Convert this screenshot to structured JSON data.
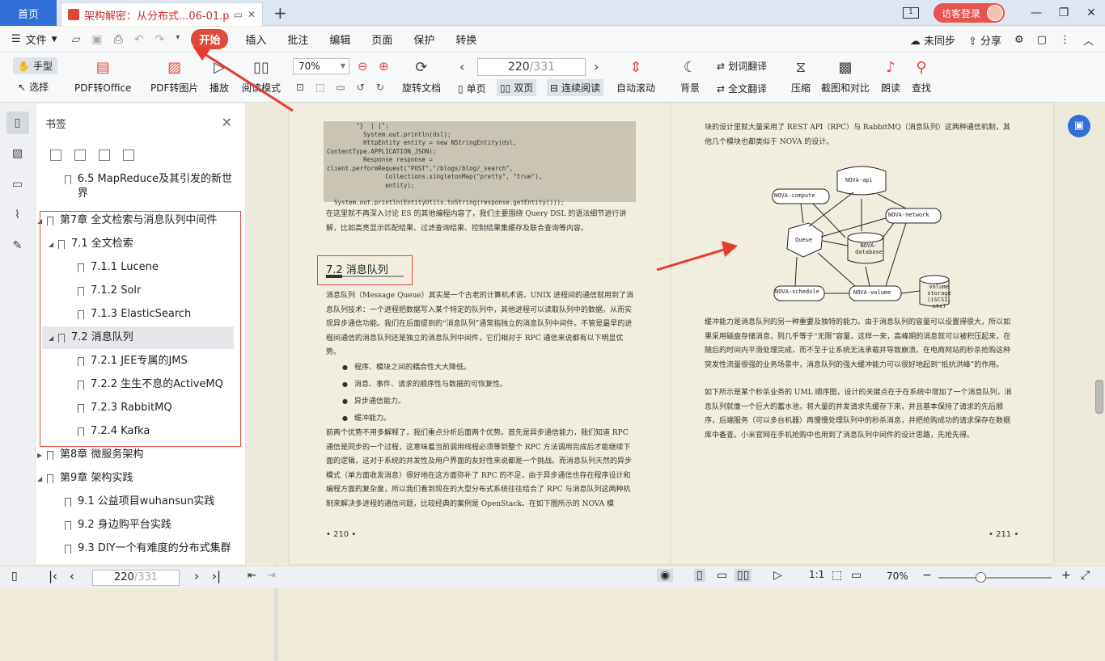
{
  "tabs": {
    "home": "首页",
    "doc": "架构解密：从分布式...06-01.pdf"
  },
  "header": {
    "login": "访客登录"
  },
  "menu": {
    "file": "文件",
    "items": [
      "开始",
      "插入",
      "批注",
      "编辑",
      "页面",
      "保护",
      "转换"
    ],
    "sync": "未同步",
    "share": "分享"
  },
  "ribbon": {
    "hand": "手型",
    "select": "选择",
    "pdf_office": "PDF转Office",
    "pdf_image": "PDF转图片",
    "play": "播放",
    "read_mode": "阅读模式",
    "zoom": "70%",
    "rotate": "旋转文档",
    "page_current": "220",
    "page_total": "/331",
    "single": "单页",
    "double": "双页",
    "continuous": "连续阅读",
    "auto_scroll": "自动滚动",
    "background": "背景",
    "word_translate": "划词翻译",
    "full_translate": "全文翻译",
    "compress": "压缩",
    "screenshot_compare": "截图和对比",
    "read_aloud": "朗读",
    "find": "查找"
  },
  "bookmarks": {
    "title": "书签",
    "items": [
      {
        "label": "6.5 MapReduce及其引发的新世界",
        "level": 1
      },
      {
        "label": "第7章 全文检索与消息队列中间件",
        "level": 0
      },
      {
        "label": "7.1 全文检索",
        "level": 1
      },
      {
        "label": "7.1.1 Lucene",
        "level": 2
      },
      {
        "label": "7.1.2 Solr",
        "level": 2
      },
      {
        "label": "7.1.3 ElasticSearch",
        "level": 2
      },
      {
        "label": "7.2 消息队列",
        "level": 1
      },
      {
        "label": "7.2.1 JEE专属的JMS",
        "level": 2
      },
      {
        "label": "7.2.2 生生不息的ActiveMQ",
        "level": 2
      },
      {
        "label": "7.2.3 RabbitMQ",
        "level": 2
      },
      {
        "label": "7.2.4 Kafka",
        "level": 2
      },
      {
        "label": "第8章 微服务架构",
        "level": 0
      },
      {
        "label": "第9章 架构实践",
        "level": 0
      },
      {
        "label": "9.1 公益项目wuhansun实践",
        "level": 1
      },
      {
        "label": "9.2 身边购平台实践",
        "level": 1
      },
      {
        "label": "9.3 DIY一个有难度的分布式集群",
        "level": 1
      }
    ]
  },
  "left_page": {
    "code": "        \"}  | |\";\n          System.out.println(dsl);\n          HttpEntity entity = new NStringEntity(dsl,\nContentType.APPLICATION_JSON);\n          Response response =\nclient.performRequest(\"POST\",\"/blogs/blog/_search\",\n                Collections.singletonMap(\"pretty\", \"true\"),\n                entity);\n\n  System.out.println(EntityUtils.toString(response.getEntity()));",
    "para1": "在这里就不再深入讨论 ES 的其他编程内容了，我们主要围绕 Query DSL 的语法细节进行讲解，比如高亮显示匹配结果、过滤查询结果、控制结果集缓存及联合查询等内容。",
    "section": "7.2   消息队列",
    "para2": "消息队列（Message Queue）其实是一个古老的计算机术语，UNIX 进程间的通信就用到了消息队列技术：一个进程把数据写入某个特定的队列中，其他进程可以读取队列中的数据，从而实现异步通信功能。我们在后面提到的“消息队列”通常指独立的消息队列中间件。不管是最早的进程间通信的消息队列还是独立的消息队列中间件，它们相对于 RPC 通信来说都有以下明显优势。",
    "bullets": [
      "程序、模块之间的耦合性大大降低。",
      "消息、事件、请求的顺序性与数据的可恢复性。",
      "异步通信能力。",
      "缓冲能力。"
    ],
    "para3": "前两个优势不用多解释了，我们重点分析后面两个优势。首先是异步通信能力，我们知道 RPC 通信是同步的一个过程，这意味着当前调用线程必须等到整个 RPC 方法调用完成后才能继续下面的逻辑，这对于系统的并发性及用户界面的友好性来说都是一个挑战。而消息队列天然的异步模式（单方面收发消息）很好地在这方面弥补了 RPC 的不足，由于异步通信也存在程序设计和编程方面的复杂度，所以我们看到现在的大型分布式系统往往结合了 RPC 与消息队列这两种机制来解决多进程的通信问题，比较经典的案例是 OpenStack。在如下图所示的 NOVA 模",
    "page_no": "• 210 •"
  },
  "right_page": {
    "para1": "块的设计里就大量采用了 REST API（RPC）与 RabbitMQ（消息队列）这两种通信机制，其他几个模块也都类似于 NOVA 的设计。",
    "nodes": [
      "NOVA-api",
      "NOVA-compute",
      "NOVA-network",
      "Queue",
      "NOVA-database",
      "NOVA-schedule",
      "NOVA-volume",
      "volume storage (iSCSI, etc)"
    ],
    "para2": "缓冲能力是消息队列的另一种重要及独特的能力。由于消息队列的容量可以设置得很大，所以如果采用磁盘存储消息，则几乎等于“无限”容量，这样一来，高峰期的消息就可以被积压起来，在随后的时间内平滑处理完成，而不至于让系统无法承载并导致崩溃。在电商网站的秒杀抢购这种突发性流量很强的业务场景中，消息队列的强大缓冲能力可以很好地起到“抵抗洪峰”的作用。",
    "para3": "如下所示是某个秒杀业务的 UML 顺序图，设计的关键点在于在系统中增加了一个消息队列，消息队列就像一个巨大的蓄水池，将大量的并发请求先缓存下来，并且基本保持了请求的先后顺序，后端服务（可以多台机器）再慢慢处理队列中的秒杀消息，并把抢购成功的请求保存在数据库中备查。小米官网在手机抢购中也用到了消息队列中间件的设计思路，先抢先得。",
    "page_no": "• 211 •"
  },
  "bottom": {
    "page_current": "220",
    "page_total": "/331",
    "zoom": "70%"
  },
  "colors": {
    "accent": "#2f6fd6",
    "red": "#e04a3a"
  }
}
